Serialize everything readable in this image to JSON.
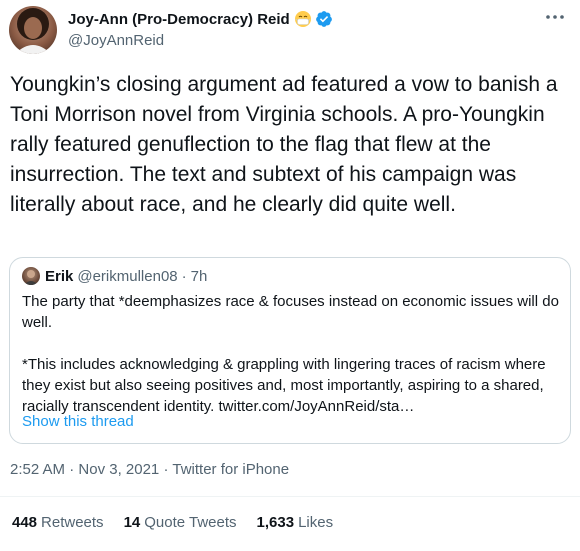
{
  "author": {
    "display_name": "Joy-Ann (Pro-Democracy) Reid",
    "emoji": "face-with-medical-mask",
    "verified": true,
    "handle": "@JoyAnnReid"
  },
  "tweet": {
    "text": "Youngkin’s closing argument ad featured a vow to banish a Toni Morrison novel from Virginia schools. A pro-Youngkin rally featured genuflection to the flag that flew at the insurrection. The text and subtext of his campaign was literally about race, and he clearly did quite well.",
    "time": "2:52 AM",
    "date": "Nov 3, 2021",
    "source": "Twitter for iPhone",
    "separator": "·"
  },
  "quote": {
    "name": "Erik",
    "handle": "@erikmullen08",
    "separator": "·",
    "age": "7h",
    "paragraph1": "The party that *deemphasizes race & focuses instead on economic issues will do well.",
    "paragraph2": "*This includes acknowledging & grappling with lingering traces of racism where they exist but also seeing positives and, most importantly, aspiring to a shared, racially transcendent identity. twitter.com/JoyAnnReid/sta…",
    "show_thread": "Show this thread"
  },
  "stats": {
    "retweets_count": "448",
    "retweets_label": "Retweets",
    "quotes_count": "14",
    "quotes_label": "Quote Tweets",
    "likes_count": "1,633",
    "likes_label": "Likes"
  },
  "colors": {
    "link": "#1d9bf0",
    "secondary_text": "#536471",
    "border": "#cfd9de",
    "verified": "#1d9bf0"
  }
}
